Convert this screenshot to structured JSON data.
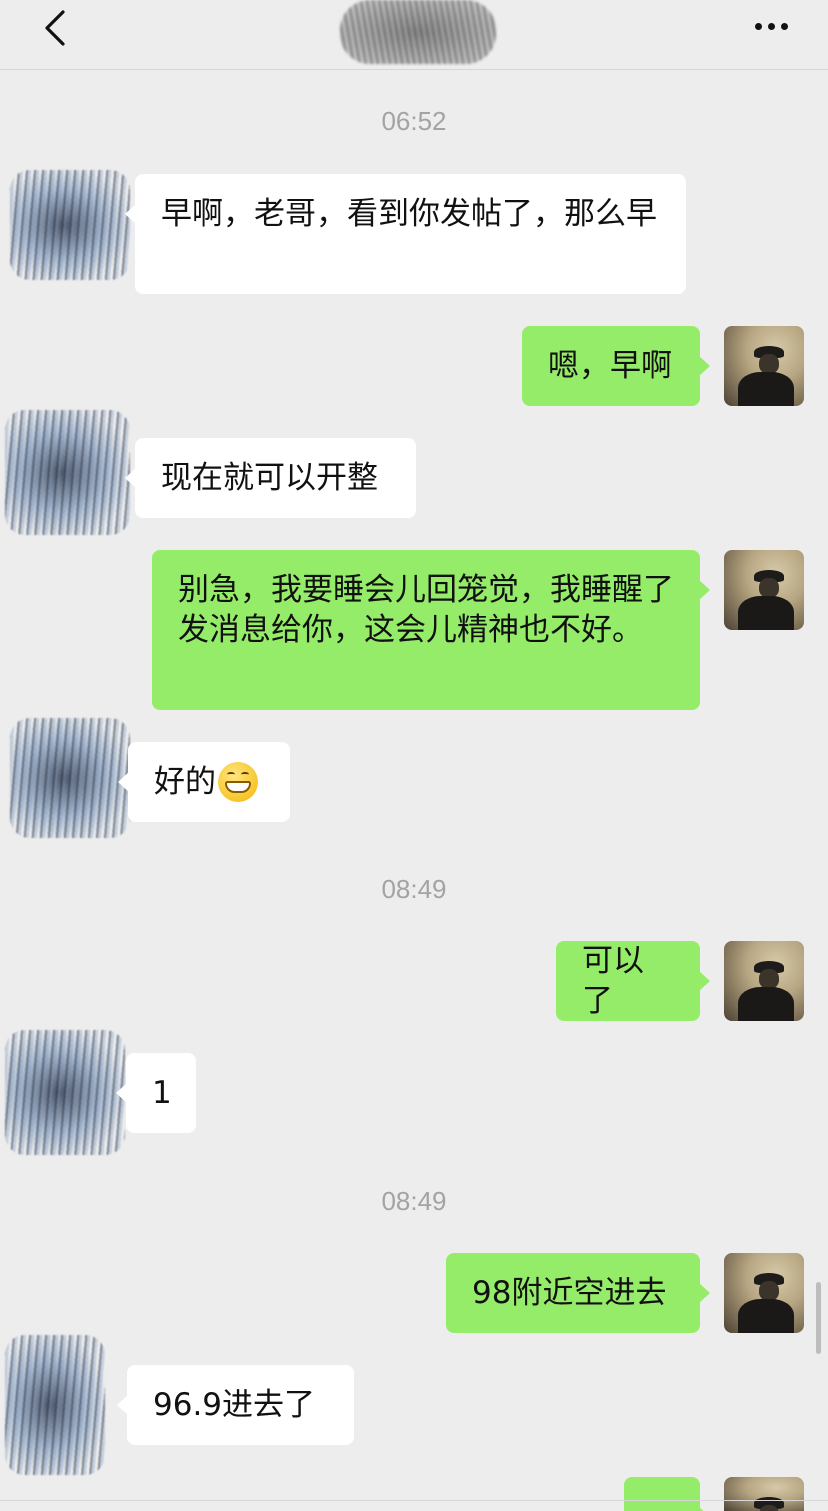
{
  "header": {
    "back_icon": "chevron-left-icon",
    "contact_name_redacted": true,
    "more_icon": "more-dots-icon"
  },
  "timestamps": [
    "06:52",
    "08:49",
    "08:49"
  ],
  "messages": [
    {
      "from": "them",
      "text": "早啊，老哥，看到你发帖了，那么早"
    },
    {
      "from": "me",
      "text": "嗯，早啊"
    },
    {
      "from": "them",
      "text": "现在就可以开整"
    },
    {
      "from": "me",
      "text": "别急，我要睡会儿回笼觉，我睡醒了发消息给你，这会儿精神也不好。"
    },
    {
      "from": "them",
      "text": "好的",
      "emoji": "grinning-face-icon"
    },
    {
      "from": "me",
      "text": "可以了"
    },
    {
      "from": "them",
      "text": "1"
    },
    {
      "from": "me",
      "text": "98附近空进去"
    },
    {
      "from": "them",
      "text": "96.9进去了"
    },
    {
      "from": "me",
      "text": ""
    }
  ],
  "colors": {
    "background": "#ededed",
    "my_bubble": "#95ec69",
    "their_bubble": "#ffffff",
    "timestamp_text": "#a3a3a3"
  }
}
